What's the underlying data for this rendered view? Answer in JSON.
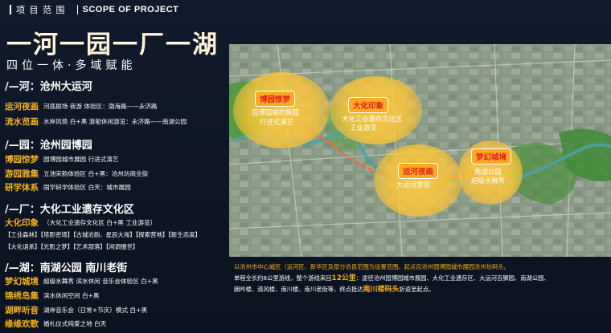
{
  "header": {
    "section_cn": "项 目 范 围",
    "section_en": "SCOPE OF PROJECT"
  },
  "title": "一河一园一厂一湖",
  "subtitle": "四位一体·多域赋能",
  "sections": [
    {
      "heading": "/—河：沧州大运河",
      "rows": [
        {
          "key": "运河夜画",
          "value": "河底剧场  夜游 体验区：渤海路——永济路"
        },
        {
          "key": "流水览画",
          "value": "水岸风情  白+黑  游船休闲游览：永济路——南湖公园"
        }
      ]
    },
    {
      "heading": "/—园：沧州园博园",
      "rows": [
        {
          "key": "博园惊梦",
          "value": "园博园城市展园  行进式演艺"
        },
        {
          "key": "游园雅集",
          "value": "五池宋韵体验区  白+黑：沧州坊商业街"
        },
        {
          "key": "研学体系",
          "value": "国学研学体验区  白天：城市展园"
        }
      ]
    },
    {
      "heading": "/—厂：大化工业遗存文化区",
      "rows": [
        {
          "key": "大化印象",
          "value": "（大化工业遗存文化区  白+黑  工业游览）"
        }
      ],
      "tags": [
        "【工业森林】【塔影密境】【古城沧韵、星辰大海】【探索营地】【新生态度】",
        "【大化语系】【光影之梦】【艺术部落】【闲调慢世】"
      ]
    },
    {
      "heading": "/—湖：南湖公园  南川老街",
      "rows": [
        {
          "key": "梦幻城境",
          "value": "超级水舞秀  滨水休闲  音乐会体验区  白+黑"
        },
        {
          "key": "锦绣岛集",
          "value": "滨水休闲空间  白+黑"
        },
        {
          "key": "湖畔听音",
          "value": "湖岸音乐会（日常+节庆）模式  白+黑"
        },
        {
          "key": "缘缘欢歌",
          "value": "婚礼仪式纯爱之地  白天"
        }
      ]
    }
  ],
  "map": {
    "zones": [
      {
        "label": "博园惊梦",
        "text": [
          "园博园城市展园",
          "行进式演艺"
        ]
      },
      {
        "label": "大化印象",
        "text": [
          "大化工业遗存文化区",
          "工业游览"
        ]
      },
      {
        "label": "运河夜画",
        "text": [
          "大运河游览"
        ]
      },
      {
        "label": "梦幻城境",
        "text": [
          "南湖公园",
          "超级水舞秀"
        ]
      }
    ]
  },
  "description": {
    "line1": "以沧州市中心城区（运河区、新华区及部分沧县范围为设置范围，起点自沧州园博园城市展园沧州坊码头。",
    "line2_a": "单程全长约6公里游线，整个游线来回",
    "line2_hl": "12公里",
    "line2_b": "：途径沧州园博园城市展园、大化工业遗存区、大运河百狮园、南湖公园、",
    "line3_a": "朗吟楼、清风楼、南川楼、南川老街等，终点抵达",
    "line3_hl": "南川楼码头",
    "line3_b": "折返至起点。"
  },
  "colors": {
    "accent": "#f2b11b",
    "background": "#0d1424",
    "label_bg": "#f9aa22",
    "label_text": "#e02020",
    "route": "#f06a2a"
  }
}
